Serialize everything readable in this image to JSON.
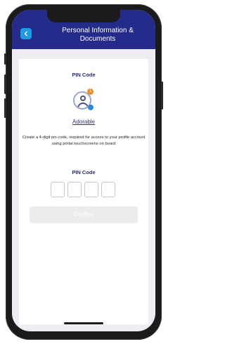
{
  "header": {
    "title": "Personal Information & Documents",
    "back_icon": "chevron-left-icon",
    "background_color": "#252b8a",
    "back_button_color": "#1e9be3"
  },
  "content": {
    "section_title": "PIN Code",
    "profile": {
      "avatar_icon": "user-avatar-icon",
      "badge_count": "1",
      "name": "Adorable"
    },
    "description": "Create a 4-digit pin code, required for access to your profile account using portal touchscreens on board",
    "pin_label": "PIN Code",
    "pin_digits": [
      "",
      "",
      "",
      ""
    ],
    "confirm_label": "Confirm"
  }
}
